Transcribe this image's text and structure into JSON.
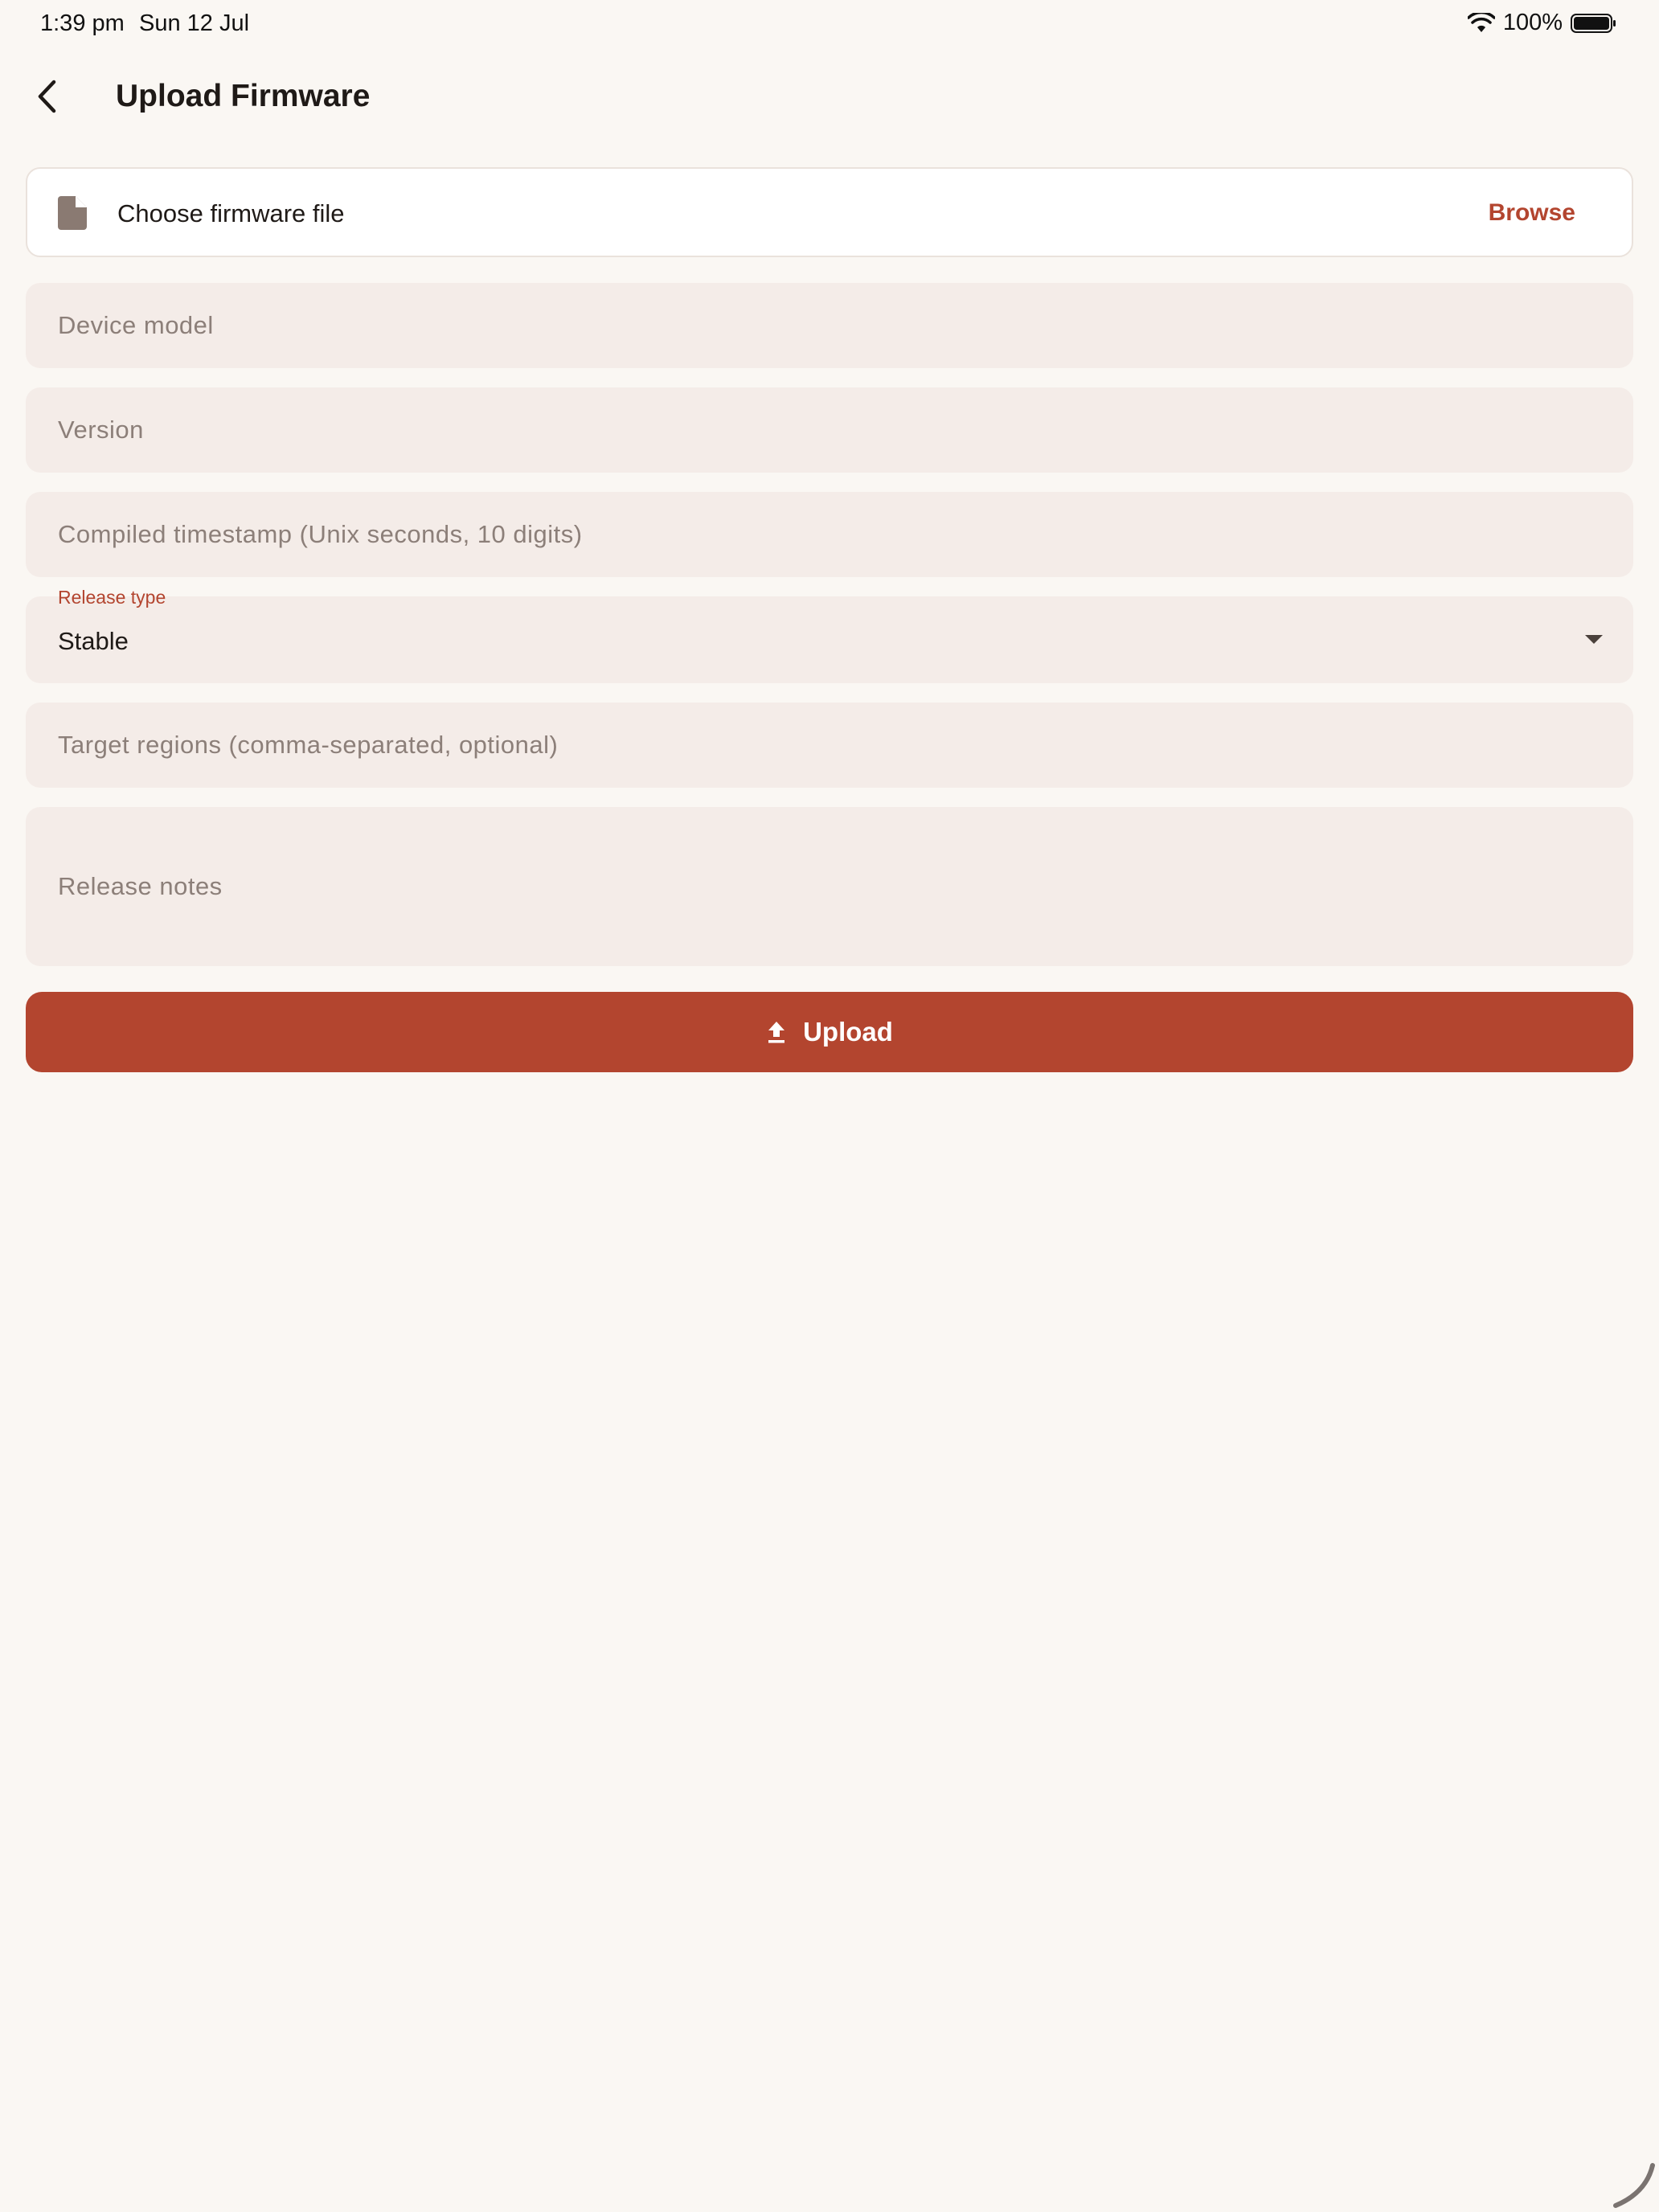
{
  "status_bar": {
    "time": "1:39 pm",
    "date": "Sun 12 Jul",
    "battery": "100%",
    "icons": [
      "wifi-icon",
      "battery-icon"
    ]
  },
  "header": {
    "back_icon": "chevron-left-icon",
    "title": "Upload Firmware"
  },
  "file_picker": {
    "icon": "file-icon",
    "label": "Choose firmware file",
    "browse_label": "Browse"
  },
  "fields": {
    "device_model": {
      "placeholder": "Device model",
      "value": ""
    },
    "version": {
      "placeholder": "Version",
      "value": ""
    },
    "compiled_timestamp": {
      "placeholder": "Compiled timestamp (Unix seconds, 10 digits)",
      "value": ""
    },
    "release_type": {
      "label": "Release type",
      "value": "Stable",
      "icon": "dropdown-arrow-icon"
    },
    "target_regions": {
      "placeholder": "Target regions (comma-separated, optional)",
      "value": ""
    },
    "release_notes": {
      "placeholder": "Release notes",
      "value": ""
    }
  },
  "upload_button": {
    "icon": "upload-icon",
    "label": "Upload"
  },
  "colors": {
    "background": "#FAF7F3",
    "accent": "#B3452F",
    "field_background": "#F4ECE8",
    "placeholder_text": "#8C7F79"
  }
}
